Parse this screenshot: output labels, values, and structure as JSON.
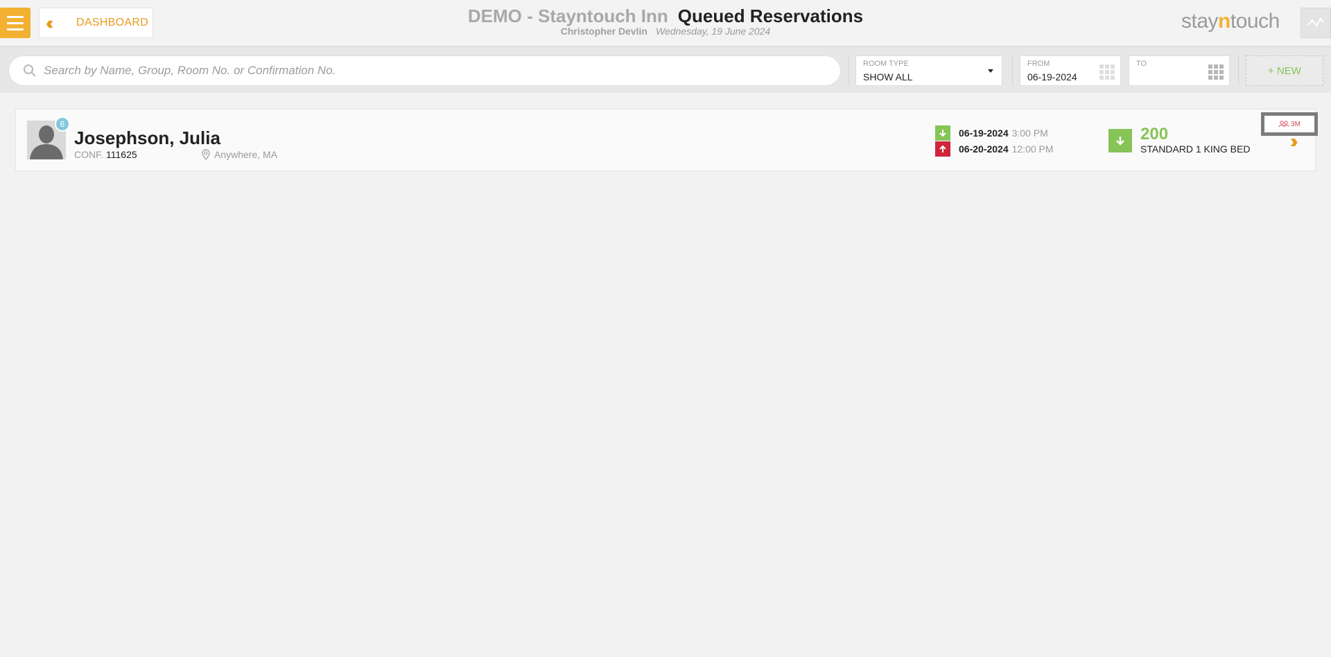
{
  "header": {
    "back_label": "DASHBOARD",
    "hotel_name": "DEMO - Stayntouch Inn",
    "page_title": "Queued Reservations",
    "user_name": "Christopher Devlin",
    "business_date": "Wednesday, 19 June 2024",
    "logo_prefix": "stay",
    "logo_n": "n",
    "logo_suffix": "touch"
  },
  "toolbar": {
    "search_placeholder": "Search by Name, Group, Room No. or Confirmation No.",
    "search_value": "",
    "room_type_caption": "ROOM TYPE",
    "room_type_value": "SHOW ALL",
    "from_caption": "FROM",
    "from_value": "06-19-2024",
    "to_caption": "TO",
    "to_value": "",
    "new_label": "+ NEW"
  },
  "reservations": [
    {
      "guest_name": "Josephson, Julia",
      "badge_count": "6",
      "conf_label": "CONF.",
      "conf_number": "111625",
      "location": "Anywhere, MA",
      "arrival_date": "06-19-2024",
      "arrival_time": "3:00 PM",
      "departure_date": "06-20-2024",
      "departure_time": "12:00 PM",
      "room_number": "200",
      "room_type": "STANDARD 1 KING BED",
      "tag": "3M"
    }
  ],
  "colors": {
    "accent_orange": "#f3b132",
    "link_orange": "#e89a1d",
    "status_green": "#86c456",
    "departure_red": "#d1243b",
    "badge_blue": "#84c7e0"
  },
  "icons": [
    "menu-icon",
    "double-chevron-left-icon",
    "activity-icon",
    "search-icon",
    "calendar-icon",
    "location-pin-icon",
    "arrival-arrow-icon",
    "departure-arrow-icon",
    "room-status-icon",
    "guest-tag-icon",
    "double-chevron-right-icon"
  ]
}
